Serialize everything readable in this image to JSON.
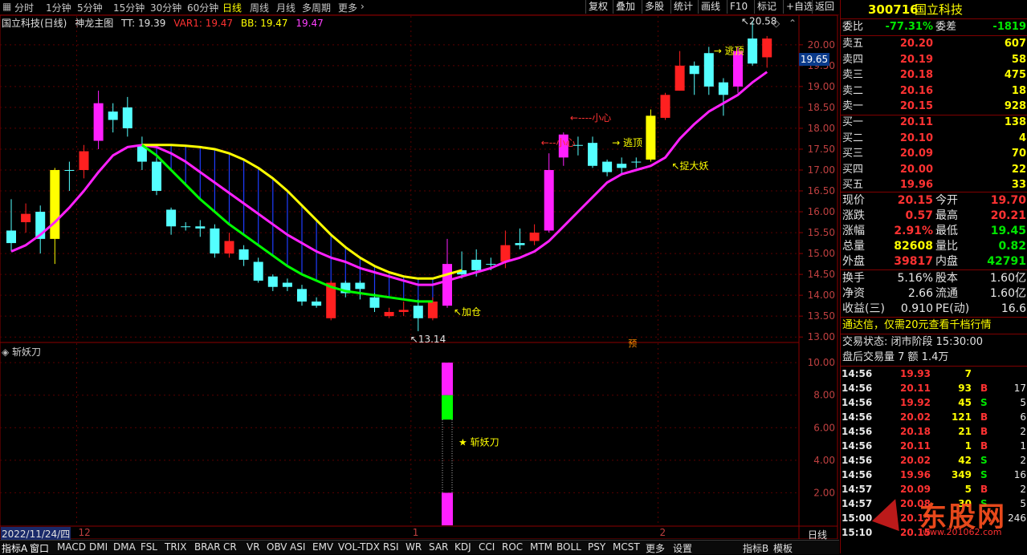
{
  "toolbar": {
    "periods": [
      "分时",
      "1分钟",
      "5分钟",
      "15分钟",
      "30分钟",
      "60分钟",
      "日线",
      "周线",
      "月线",
      "多周期",
      "更多"
    ],
    "active_period": "日线",
    "right_buttons": [
      "复权",
      "叠加",
      "多股",
      "统计",
      "画线",
      "F10",
      "标记",
      "+自选",
      "返回"
    ]
  },
  "chart_info": {
    "name": "国立科技(日线)",
    "indicator": "神龙主图",
    "tt": "TT: 19.39",
    "var1": "VAR1: 19.47",
    "bb": "BB: 19.47",
    "extra": "19.47"
  },
  "sub_info": {
    "indicator": "斩妖刀"
  },
  "chart_data": {
    "type": "candlestick",
    "main": {
      "y_ticks": [
        13.0,
        13.5,
        14.0,
        14.5,
        15.0,
        15.5,
        16.0,
        16.5,
        17.0,
        17.5,
        18.0,
        18.5,
        19.0,
        19.5,
        20.0
      ],
      "ylim": [
        12.85,
        20.65
      ],
      "current_price_label": "19.65",
      "high_label": "20.58",
      "low_label": "13.14",
      "candles": [
        {
          "o": 15.55,
          "c": 15.25,
          "h": 16.3,
          "l": 15.05,
          "color": "cyan"
        },
        {
          "o": 15.75,
          "c": 15.95,
          "h": 16.2,
          "l": 15.5,
          "color": "red"
        },
        {
          "o": 15.35,
          "c": 16.0,
          "h": 16.15,
          "l": 15.0,
          "color": "cyan"
        },
        {
          "o": 15.35,
          "c": 17.0,
          "h": 17.05,
          "l": 14.75,
          "color": "yellow"
        },
        {
          "o": 17.0,
          "c": 17.0,
          "h": 17.2,
          "l": 16.5,
          "color": "cyan"
        },
        {
          "o": 17.45,
          "c": 17.0,
          "h": 17.6,
          "l": 16.8,
          "color": "red"
        },
        {
          "o": 17.7,
          "c": 18.6,
          "h": 18.9,
          "l": 17.5,
          "color": "magenta"
        },
        {
          "o": 18.4,
          "c": 18.2,
          "h": 18.6,
          "l": 17.9,
          "color": "cyan"
        },
        {
          "o": 18.5,
          "c": 18.0,
          "h": 18.75,
          "l": 17.8,
          "color": "cyan"
        },
        {
          "o": 17.6,
          "c": 17.2,
          "h": 17.8,
          "l": 17.0,
          "color": "cyan"
        },
        {
          "o": 17.2,
          "c": 16.5,
          "h": 17.3,
          "l": 16.4,
          "color": "cyan"
        },
        {
          "o": 16.05,
          "c": 15.65,
          "h": 16.1,
          "l": 15.45,
          "color": "cyan"
        },
        {
          "o": 15.65,
          "c": 15.65,
          "h": 15.75,
          "l": 15.55,
          "color": "cyan"
        },
        {
          "o": 15.65,
          "c": 15.6,
          "h": 15.8,
          "l": 15.4,
          "color": "cyan"
        },
        {
          "o": 15.6,
          "c": 15.0,
          "h": 15.7,
          "l": 14.9,
          "color": "cyan"
        },
        {
          "o": 15.3,
          "c": 15.0,
          "h": 15.5,
          "l": 14.9,
          "color": "red"
        },
        {
          "o": 15.1,
          "c": 14.85,
          "h": 15.2,
          "l": 14.7,
          "color": "cyan"
        },
        {
          "o": 14.8,
          "c": 14.35,
          "h": 14.9,
          "l": 14.3,
          "color": "cyan"
        },
        {
          "o": 14.45,
          "c": 14.2,
          "h": 14.5,
          "l": 14.1,
          "color": "cyan"
        },
        {
          "o": 14.3,
          "c": 14.2,
          "h": 14.4,
          "l": 14.1,
          "color": "cyan"
        },
        {
          "o": 14.15,
          "c": 13.85,
          "h": 14.25,
          "l": 13.75,
          "color": "cyan"
        },
        {
          "o": 13.85,
          "c": 13.75,
          "h": 13.95,
          "l": 13.7,
          "color": "cyan"
        },
        {
          "o": 13.45,
          "c": 14.3,
          "h": 14.35,
          "l": 13.4,
          "color": "red"
        },
        {
          "o": 14.3,
          "c": 14.05,
          "h": 14.35,
          "l": 13.95,
          "color": "cyan"
        },
        {
          "o": 14.3,
          "c": 14.15,
          "h": 14.35,
          "l": 13.9,
          "color": "cyan"
        },
        {
          "o": 13.95,
          "c": 13.7,
          "h": 14.05,
          "l": 13.6,
          "color": "cyan"
        },
        {
          "o": 13.5,
          "c": 13.6,
          "h": 13.7,
          "l": 13.45,
          "color": "red"
        },
        {
          "o": 13.6,
          "c": 13.65,
          "h": 13.85,
          "l": 13.5,
          "color": "red"
        },
        {
          "o": 13.75,
          "c": 13.45,
          "h": 13.9,
          "l": 13.14,
          "color": "cyan"
        },
        {
          "o": 13.45,
          "c": 13.85,
          "h": 13.95,
          "l": 13.4,
          "color": "red"
        },
        {
          "o": 13.75,
          "c": 14.75,
          "h": 15.35,
          "l": 13.7,
          "color": "magenta"
        },
        {
          "o": 14.6,
          "c": 14.5,
          "h": 15.05,
          "l": 14.4,
          "color": "cyan"
        },
        {
          "o": 14.6,
          "c": 14.85,
          "h": 15.1,
          "l": 14.45,
          "color": "cyan"
        },
        {
          "o": 14.75,
          "c": 14.75,
          "h": 14.9,
          "l": 14.6,
          "color": "cyan"
        },
        {
          "o": 14.8,
          "c": 15.2,
          "h": 15.55,
          "l": 14.65,
          "color": "red"
        },
        {
          "o": 15.2,
          "c": 15.25,
          "h": 15.6,
          "l": 15.1,
          "color": "cyan"
        },
        {
          "o": 15.3,
          "c": 15.5,
          "h": 15.7,
          "l": 15.2,
          "color": "red"
        },
        {
          "o": 15.55,
          "c": 17.0,
          "h": 17.4,
          "l": 15.5,
          "color": "magenta"
        },
        {
          "o": 17.3,
          "c": 17.85,
          "h": 17.9,
          "l": 17.1,
          "color": "magenta"
        },
        {
          "o": 17.6,
          "c": 17.6,
          "h": 17.8,
          "l": 17.35,
          "color": "cyan"
        },
        {
          "o": 17.65,
          "c": 17.1,
          "h": 17.8,
          "l": 17.05,
          "color": "cyan"
        },
        {
          "o": 17.2,
          "c": 16.95,
          "h": 17.25,
          "l": 16.85,
          "color": "cyan"
        },
        {
          "o": 17.15,
          "c": 17.05,
          "h": 17.3,
          "l": 16.9,
          "color": "cyan"
        },
        {
          "o": 17.2,
          "c": 17.2,
          "h": 17.3,
          "l": 17.05,
          "color": "cyan"
        },
        {
          "o": 17.25,
          "c": 18.3,
          "h": 18.45,
          "l": 17.2,
          "color": "yellow"
        },
        {
          "o": 18.25,
          "c": 18.8,
          "h": 18.85,
          "l": 18.2,
          "color": "red"
        },
        {
          "o": 18.9,
          "c": 19.5,
          "h": 19.85,
          "l": 18.9,
          "color": "red"
        },
        {
          "o": 19.5,
          "c": 19.3,
          "h": 19.6,
          "l": 18.8,
          "color": "cyan"
        },
        {
          "o": 19.8,
          "c": 19.0,
          "h": 19.95,
          "l": 18.8,
          "color": "cyan"
        },
        {
          "o": 19.1,
          "c": 18.8,
          "h": 19.2,
          "l": 18.3,
          "color": "cyan"
        },
        {
          "o": 19.0,
          "c": 19.85,
          "h": 19.95,
          "l": 18.85,
          "color": "magenta"
        },
        {
          "o": 19.55,
          "c": 20.15,
          "h": 20.58,
          "l": 19.5,
          "color": "cyan"
        },
        {
          "o": 19.7,
          "c": 20.15,
          "h": 20.21,
          "l": 19.45,
          "color": "red"
        }
      ],
      "magenta_line": [
        15.05,
        15.2,
        15.45,
        15.75,
        16.1,
        16.5,
        16.95,
        17.35,
        17.55,
        17.6,
        17.55,
        17.4,
        17.2,
        16.95,
        16.7,
        16.45,
        16.2,
        15.95,
        15.7,
        15.45,
        15.25,
        15.05,
        14.9,
        14.8,
        14.65,
        14.55,
        14.45,
        14.35,
        14.25,
        14.25,
        14.35,
        14.45,
        14.55,
        14.65,
        14.8,
        14.9,
        15.05,
        15.3,
        15.65,
        16.0,
        16.35,
        16.7,
        16.9,
        17.0,
        17.1,
        17.3,
        17.75,
        18.1,
        18.4,
        18.6,
        18.8,
        19.1,
        19.35
      ],
      "yellow_line": {
        "start": 9,
        "values": [
          17.6,
          17.6,
          17.6,
          17.58,
          17.55,
          17.5,
          17.4,
          17.25,
          17.05,
          16.8,
          16.5,
          16.15,
          15.8,
          15.45,
          15.15,
          14.9,
          14.7,
          14.55,
          14.45,
          14.4,
          14.4,
          14.5,
          14.6
        ]
      },
      "green_line": {
        "start": 9,
        "values": [
          17.6,
          17.35,
          17.0,
          16.65,
          16.3,
          16.0,
          15.7,
          15.45,
          15.2,
          14.95,
          14.7,
          14.5,
          14.35,
          14.2,
          14.1,
          14.05,
          14.0,
          13.95,
          13.9,
          13.85,
          13.85
        ]
      },
      "annotations": [
        {
          "i": 30,
          "price": 13.6,
          "text": "↖加仓",
          "color": "yellow"
        },
        {
          "i": 39,
          "price": 18.25,
          "text": "←----小心",
          "color": "red"
        },
        {
          "i": 37,
          "price": 17.65,
          "text": "←--小心",
          "color": "red"
        },
        {
          "i": 41,
          "price": 17.65,
          "text": "→ 逃顶",
          "color": "yellow"
        },
        {
          "i": 45,
          "price": 17.1,
          "text": "↖捉大妖",
          "color": "yellow"
        },
        {
          "i": 48,
          "price": 19.85,
          "text": "→ 逃顶",
          "color": "yellow"
        },
        {
          "i": 42,
          "price": 12.85,
          "text": "预",
          "color": "orange"
        }
      ]
    },
    "sub": {
      "indicator": "斩妖刀",
      "y_ticks": [
        2.0,
        4.0,
        6.0,
        8.0,
        10.0
      ],
      "ylim": [
        0.0,
        10.6
      ],
      "bars": [
        {
          "i": 30,
          "from": 8.0,
          "to": 10.0,
          "color": "magenta"
        },
        {
          "i": 30,
          "from": 6.5,
          "to": 8.0,
          "color": "lime"
        },
        {
          "i": 30,
          "from": 0.0,
          "to": 2.0,
          "color": "magenta"
        }
      ],
      "label": {
        "i": 30,
        "value": 5.1,
        "text": "★ 斩妖刀"
      }
    },
    "x_labels": [
      {
        "i": -6,
        "text": "2022/11/24/四"
      },
      {
        "i": 5,
        "text": "12"
      },
      {
        "i": 28,
        "text": "1"
      },
      {
        "i": 45,
        "text": "2"
      }
    ]
  },
  "bottom_tabs": [
    "指标A",
    "窗口",
    "MACD",
    "DMI",
    "DMA",
    "FSL",
    "TRIX",
    "BRAR",
    "CR",
    "VR",
    "OBV",
    "ASI",
    "EMV",
    "VOL-TDX",
    "RSI",
    "WR",
    "SAR",
    "KDJ",
    "CCI",
    "ROC",
    "MTM",
    "BOLL",
    "PSY",
    "MCST",
    "更多",
    "设置"
  ],
  "bottom_right": [
    "指标B",
    "模板",
    "日线"
  ],
  "right_panel": {
    "code": "300716",
    "name": "国立科技",
    "weibi_label": "委比",
    "weibi": "-77.31%",
    "weicha_label": "委差",
    "weicha": "-1819",
    "asks": [
      {
        "label": "卖五",
        "price": "20.20",
        "vol": "607"
      },
      {
        "label": "卖四",
        "price": "20.19",
        "vol": "58"
      },
      {
        "label": "卖三",
        "price": "20.18",
        "vol": "475"
      },
      {
        "label": "卖二",
        "price": "20.16",
        "vol": "18"
      },
      {
        "label": "卖一",
        "price": "20.15",
        "vol": "928"
      }
    ],
    "bids": [
      {
        "label": "买一",
        "price": "20.11",
        "vol": "138"
      },
      {
        "label": "买二",
        "price": "20.10",
        "vol": "4"
      },
      {
        "label": "买三",
        "price": "20.09",
        "vol": "70"
      },
      {
        "label": "买四",
        "price": "20.00",
        "vol": "22"
      },
      {
        "label": "买五",
        "price": "19.96",
        "vol": "33"
      }
    ],
    "stats": [
      {
        "l1": "现价",
        "v1": "20.15",
        "c1": "red",
        "l2": "今开",
        "v2": "19.70",
        "c2": "red"
      },
      {
        "l1": "涨跌",
        "v1": "0.57",
        "c1": "red",
        "l2": "最高",
        "v2": "20.21",
        "c2": "red"
      },
      {
        "l1": "涨幅",
        "v1": "2.91%",
        "c1": "red",
        "l2": "最低",
        "v2": "19.45",
        "c2": "green"
      },
      {
        "l1": "总量",
        "v1": "82608",
        "c1": "yellow",
        "l2": "量比",
        "v2": "0.82",
        "c2": "green"
      },
      {
        "l1": "外盘",
        "v1": "39817",
        "c1": "red",
        "l2": "内盘",
        "v2": "42791",
        "c2": "green"
      }
    ],
    "stats2": [
      {
        "l1": "换手",
        "v1": "5.16%",
        "l2": "股本",
        "v2": "1.60亿"
      },
      {
        "l1": "净资",
        "v1": "2.66",
        "l2": "流通",
        "v2": "1.60亿"
      },
      {
        "l1": "收益(三)",
        "v1": "0.910",
        "l2": "PE(动)",
        "v2": "16.6"
      }
    ],
    "ad": "通达信，仅需20元查看千档行情",
    "trade_status": "交易状态: 闭市阶段 15:30:00",
    "after_hours": "盘后交易量 7 额 1.4万",
    "ticks": [
      {
        "t": "14:56",
        "p": "19.93",
        "pc": "red",
        "v": "7",
        "bs": "",
        "n": ""
      },
      {
        "t": "14:56",
        "p": "20.11",
        "pc": "red",
        "v": "93",
        "bs": "B",
        "n": "17"
      },
      {
        "t": "14:56",
        "p": "19.92",
        "pc": "red",
        "v": "45",
        "bs": "S",
        "n": "5"
      },
      {
        "t": "14:56",
        "p": "20.02",
        "pc": "red",
        "v": "121",
        "bs": "B",
        "n": "6"
      },
      {
        "t": "14:56",
        "p": "20.18",
        "pc": "red",
        "v": "21",
        "bs": "B",
        "n": "2"
      },
      {
        "t": "14:56",
        "p": "20.11",
        "pc": "red",
        "v": "1",
        "bs": "B",
        "n": "1"
      },
      {
        "t": "14:56",
        "p": "20.02",
        "pc": "red",
        "v": "42",
        "bs": "S",
        "n": "2"
      },
      {
        "t": "14:56",
        "p": "19.96",
        "pc": "red",
        "v": "349",
        "bs": "S",
        "n": "16"
      },
      {
        "t": "14:57",
        "p": "20.09",
        "pc": "red",
        "v": "5",
        "bs": "B",
        "n": "2"
      },
      {
        "t": "14:57",
        "p": "20.08",
        "pc": "red",
        "v": "30",
        "bs": "S",
        "n": "5"
      },
      {
        "t": "15:00",
        "p": "20.15",
        "pc": "red",
        "v": "",
        "bs": "",
        "n": "246"
      },
      {
        "t": "15:10",
        "p": "20.15",
        "pc": "red",
        "v": "",
        "bs": "",
        "n": ""
      }
    ],
    "watermark": "东股网",
    "watermark_sub": "www.201062.com"
  }
}
